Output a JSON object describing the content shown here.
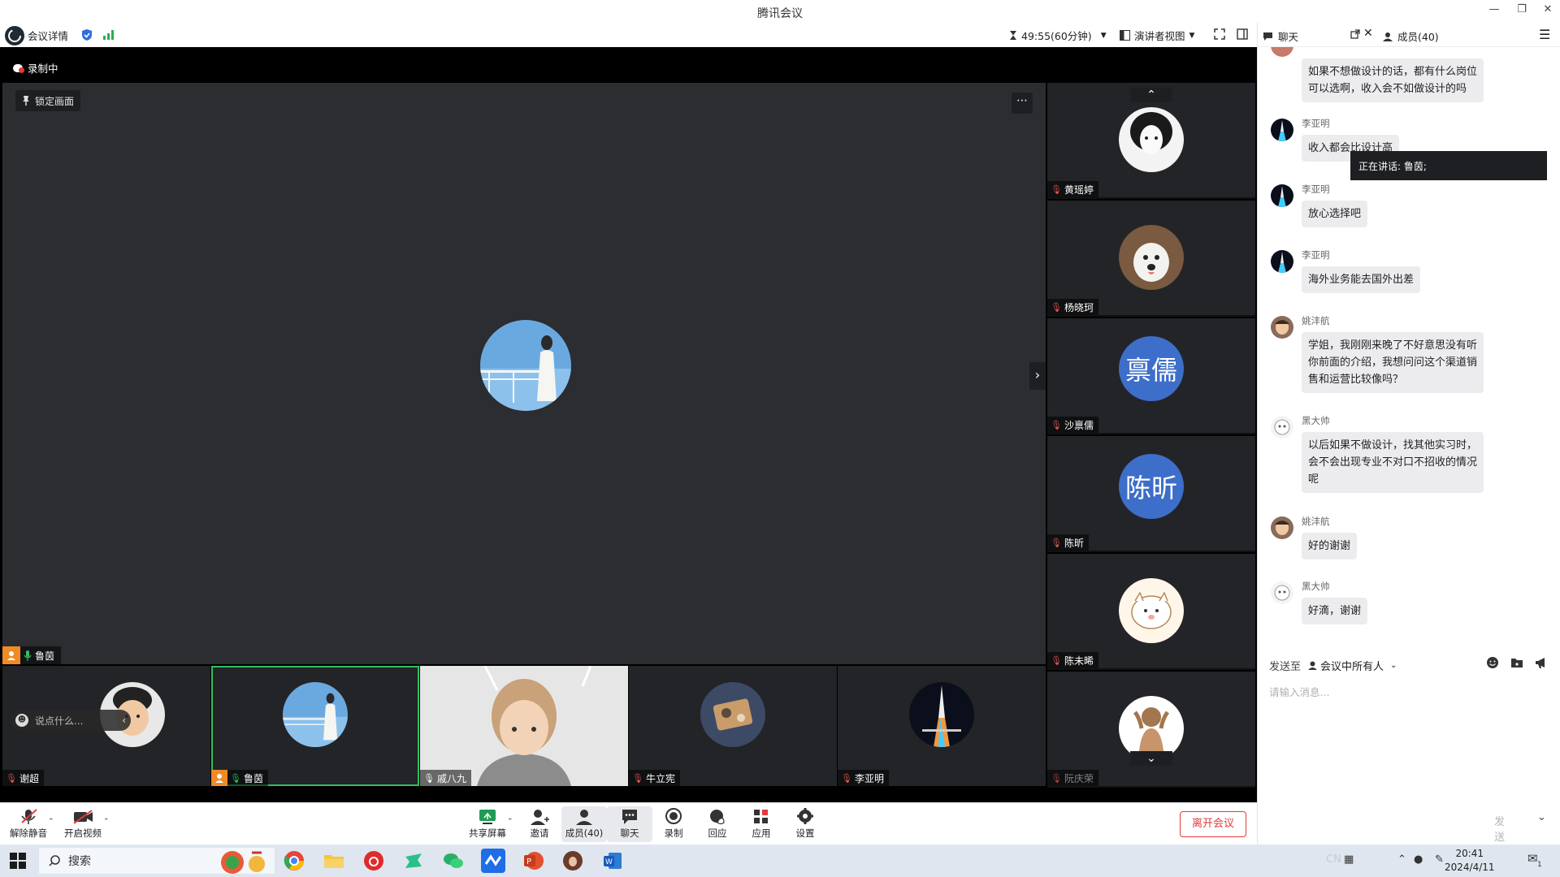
{
  "window": {
    "title": "腾讯会议"
  },
  "meetbar": {
    "details_label": "会议详情",
    "timer": "49:55(60分钟)",
    "view_label": "演讲者视图"
  },
  "video": {
    "recording_label": "录制中",
    "lock_label": "锁定画面",
    "speaker": {
      "name": "鲁茵"
    }
  },
  "side_tiles": [
    {
      "name": "黄瑶婷",
      "muted": true
    },
    {
      "name": "杨晓珂",
      "muted": true
    },
    {
      "name": "沙禀儒",
      "muted": true,
      "text_avatar": "禀儒"
    },
    {
      "name": "陈昕",
      "muted": true,
      "text_avatar": "陈昕"
    },
    {
      "name": "陈未晞",
      "muted": true
    },
    {
      "name": "阮庆荣",
      "muted": true
    }
  ],
  "bottom_tiles": [
    {
      "name": "谢超",
      "muted": true
    },
    {
      "name": "鲁茵",
      "muted": false,
      "host": true
    },
    {
      "name": "戚八九",
      "muted": false
    },
    {
      "name": "牛立宪",
      "muted": true
    },
    {
      "name": "李亚明",
      "muted": true
    }
  ],
  "say_placeholder": "说点什么...",
  "speaking_toast": "正在讲话:  鲁茵;",
  "chat": {
    "tab_chat": "聊天",
    "tab_members": "成员(40)",
    "messages": [
      {
        "sender": "",
        "lines": [
          "如果不想做设计的话，都有什么岗位",
          "可以选啊，收入会不如做设计的吗"
        ]
      },
      {
        "sender": "李亚明",
        "lines": [
          "收入都会比设计高"
        ]
      },
      {
        "sender": "李亚明",
        "lines": [
          "放心选择吧"
        ]
      },
      {
        "sender": "李亚明",
        "lines": [
          "海外业务能去国外出差"
        ]
      },
      {
        "sender": "姚沣航",
        "lines": [
          "学姐，我刚刚来晚了不好意思没有听",
          "你前面的介绍，我想问问这个渠道销",
          "售和运营比较像吗？"
        ]
      },
      {
        "sender": "黑大帅",
        "lines": [
          "以后如果不做设计，找其他实习时，",
          "会不会出现专业不对口不招收的情况",
          "呢"
        ]
      },
      {
        "sender": "姚沣航",
        "lines": [
          "好的谢谢"
        ]
      },
      {
        "sender": "黑大帅",
        "lines": [
          "好滴，谢谢"
        ]
      }
    ],
    "send_to_label": "发送至",
    "send_target": "会议中所有人",
    "input_placeholder": "请输入消息...",
    "send_label": "发送"
  },
  "toolbar": {
    "unmute": "解除静音",
    "start_video": "开启视频",
    "share": "共享屏幕",
    "invite": "邀请",
    "members": "成员(40)",
    "chat": "聊天",
    "record": "录制",
    "react": "回应",
    "apps": "应用",
    "settings": "设置",
    "leave": "离开会议"
  },
  "taskbar": {
    "search": "搜索",
    "time": "20:41",
    "date": "2024/4/11",
    "notifications": "1"
  },
  "colors": {
    "accent_blue": "#3d6ec9",
    "active_green": "#2fbf5e",
    "leave_red": "#e23b3b",
    "host_orange": "#f08a24"
  }
}
